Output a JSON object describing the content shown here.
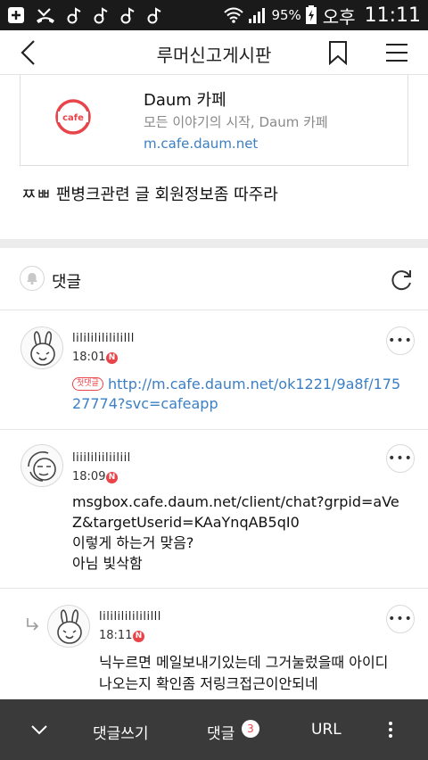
{
  "status_bar": {
    "battery_percent": "95%",
    "ampm": "오후",
    "time": "11:11",
    "icons": [
      "add-icon",
      "missed-call-icon",
      "notification-icon",
      "notification-icon",
      "notification-icon",
      "notification-icon",
      "wifi-icon",
      "signal-icon",
      "battery-icon"
    ]
  },
  "header": {
    "title": "루머신고게시판",
    "icons": [
      "back-icon",
      "bookmark-icon",
      "menu-icon"
    ]
  },
  "link_card": {
    "logo_text": "cafe",
    "title": "Daum 카페",
    "description": "모든 이야기의 시작, Daum 카페",
    "url": "m.cafe.daum.net"
  },
  "post": {
    "text": "ㅉㅃ 팬병크관련 글 회원정보좀 따주라"
  },
  "comments_header": {
    "label": "댓글"
  },
  "comments": [
    {
      "author": "lilililililililll",
      "time": "18:01",
      "badge": "N",
      "tag": "첫댓글",
      "link_line1": "http://m.cafe.daum.net/ok1221/9a8f/175",
      "link_line2": "27774?svc=cafeapp"
    },
    {
      "author": "liiililiiliiliil",
      "time": "18:09",
      "badge": "N",
      "lines": [
        "msgbox.cafe.daum.net/client/chat?grpid=aVe",
        "Z&targetUserid=KAaYnqAB5qI0",
        "이렇게 하는거 맞음?",
        "아님 빛삭함"
      ]
    },
    {
      "author": "lilililililililll",
      "time": "18:11",
      "badge": "N",
      "is_reply": true,
      "lines": [
        "닉누르면 메일보내기있는데 그거눌렀을때 아이디",
        "나오는지 확인좀 저링크접근이안되네"
      ]
    }
  ],
  "bottom_bar": {
    "write_label": "댓글쓰기",
    "comments_label": "댓글",
    "comments_count": "3",
    "url_label": "URL"
  },
  "colors": {
    "accent_red": "#e8444a",
    "link_blue": "#3b7fc4",
    "bottom_bar": "#3a3a3a"
  }
}
